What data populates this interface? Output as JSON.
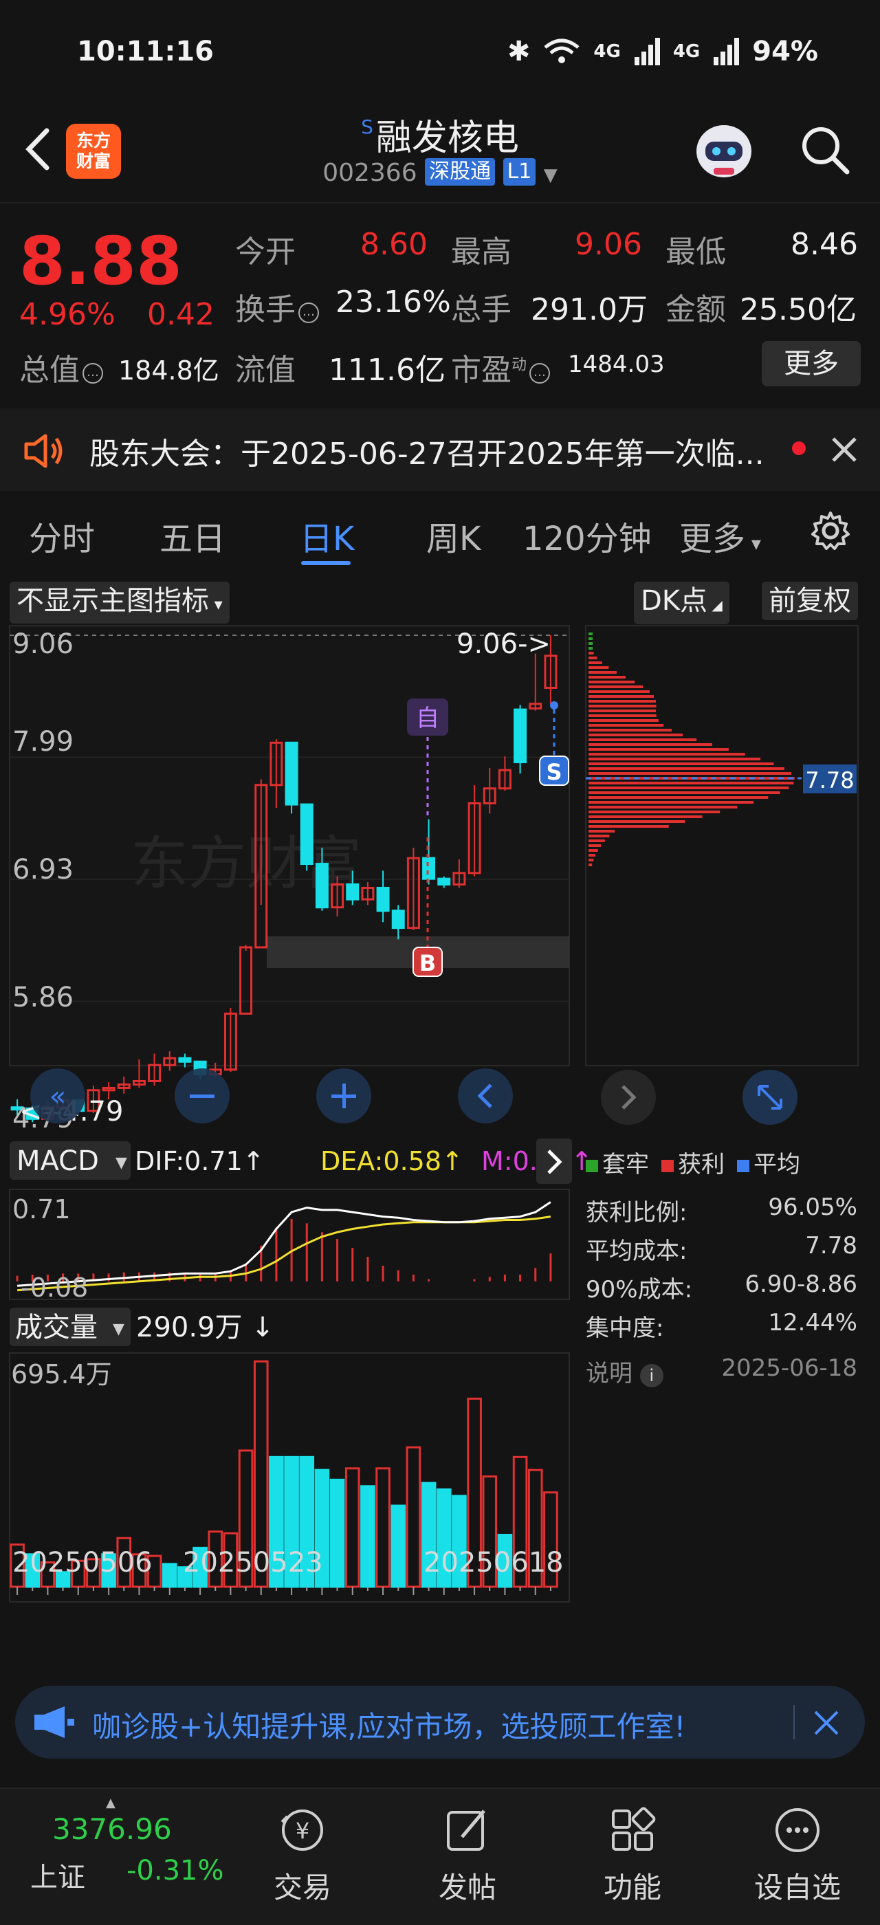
{
  "status": {
    "time": "10:11:16",
    "battery": "94%",
    "network": "4G"
  },
  "header": {
    "app_logo_line1": "东方",
    "app_logo_line2": "财富",
    "stock_name": "融发核电",
    "stock_name_prefix": "S",
    "stock_code": "002366",
    "tag_connect": "深股通",
    "tag_level": "L1"
  },
  "quote": {
    "price": "8.88",
    "change_pct": "4.96%",
    "change_abs": "0.42",
    "fields": {
      "open_label": "今开",
      "open": "8.60",
      "high_label": "最高",
      "high": "9.06",
      "low_label": "最低",
      "low": "8.46",
      "turnover_label": "换手",
      "turnover": "23.16%",
      "volume_label": "总手",
      "volume": "291.0万",
      "amount_label": "金额",
      "amount": "25.50亿",
      "mktcap_label": "总值",
      "mktcap": "184.8亿",
      "float_label": "流值",
      "float": "111.6亿",
      "pe_label": "市盈",
      "pe_sup": "动",
      "pe": "1484.03"
    },
    "more_button": "更多"
  },
  "notice": {
    "text": "股东大会：于2025-06-27召开2025年第一次临..."
  },
  "period_tabs": [
    {
      "label": "分时"
    },
    {
      "label": "五日"
    },
    {
      "label": "日K",
      "active": true
    },
    {
      "label": "周K"
    },
    {
      "label": "120分钟"
    },
    {
      "label": "更多"
    }
  ],
  "chart_toolbar": {
    "indicator_select": "不显示主图指标",
    "dk_select": "DK点",
    "adjust_select": "前复权"
  },
  "kline": {
    "y_ticks": [
      "9.06",
      "7.99",
      "6.93",
      "5.86",
      "4.79"
    ],
    "max_label": "9.06->",
    "min_label": "<--4.79",
    "chip_price_label": "7.78",
    "marker_self": "自",
    "marker_buy": "B",
    "marker_sell": "S",
    "watermark": "东方财富"
  },
  "chart_data": [
    {
      "type": "candlestick",
      "title": "",
      "ylim": [
        4.79,
        9.06
      ],
      "open": [
        4.93,
        4.92,
        4.83,
        4.93,
        4.99,
        4.9,
        5.08,
        5.1,
        5.13,
        5.16,
        5.3,
        5.36,
        5.33,
        5.22,
        5.26,
        5.75,
        6.33,
        7.75,
        8.12,
        7.58,
        7.06,
        6.68,
        6.88,
        6.75,
        6.85,
        6.65,
        6.5,
        7.11,
        6.93,
        6.88,
        6.98,
        7.59,
        7.72,
        8.41,
        8.42,
        8.6
      ],
      "close": [
        4.92,
        4.83,
        4.93,
        4.99,
        4.9,
        5.08,
        5.1,
        5.13,
        5.16,
        5.3,
        5.36,
        5.33,
        5.22,
        5.26,
        5.75,
        6.33,
        7.75,
        8.12,
        7.58,
        7.06,
        6.68,
        6.88,
        6.75,
        6.85,
        6.65,
        6.5,
        7.11,
        6.93,
        6.88,
        6.98,
        7.59,
        7.72,
        7.88,
        7.95,
        8.46,
        8.88
      ],
      "high": [
        5.0,
        4.95,
        4.98,
        5.02,
        5.0,
        5.12,
        5.15,
        5.2,
        5.35,
        5.4,
        5.42,
        5.4,
        5.3,
        5.32,
        5.8,
        6.35,
        7.8,
        8.15,
        7.75,
        7.1,
        7.2,
        6.95,
        7.0,
        6.9,
        7.0,
        6.7,
        7.2,
        7.45,
        6.95,
        7.1,
        7.75,
        7.9,
        8.0,
        8.45,
        8.9,
        9.06
      ],
      "low": [
        4.85,
        4.8,
        4.79,
        4.9,
        4.88,
        4.88,
        5.0,
        5.05,
        5.1,
        5.12,
        5.25,
        5.28,
        5.18,
        5.2,
        5.24,
        6.3,
        6.7,
        7.55,
        7.5,
        7.0,
        6.65,
        6.6,
        6.7,
        6.7,
        6.55,
        6.4,
        6.48,
        6.88,
        6.85,
        6.85,
        6.95,
        7.5,
        7.7,
        7.85,
        8.4,
        8.46
      ]
    },
    {
      "type": "line",
      "title": "MACD",
      "series": [
        {
          "name": "DIF",
          "value_label": "DIF:0.71↑"
        },
        {
          "name": "DEA",
          "value_label": "DEA:0.58↑"
        },
        {
          "name": "M",
          "value_label": "M:0.25↑"
        }
      ],
      "y_ticks": [
        "0.71",
        "-0.08"
      ],
      "dif": [
        -0.04,
        -0.03,
        -0.02,
        -0.01,
        0.0,
        0.01,
        0.02,
        0.03,
        0.04,
        0.05,
        0.06,
        0.07,
        0.07,
        0.07,
        0.09,
        0.15,
        0.28,
        0.47,
        0.62,
        0.66,
        0.64,
        0.64,
        0.62,
        0.6,
        0.58,
        0.57,
        0.55,
        0.54,
        0.53,
        0.53,
        0.54,
        0.56,
        0.57,
        0.58,
        0.62,
        0.71
      ],
      "dea": [
        -0.08,
        -0.07,
        -0.06,
        -0.05,
        -0.04,
        -0.03,
        -0.02,
        -0.01,
        0.0,
        0.01,
        0.02,
        0.03,
        0.04,
        0.04,
        0.05,
        0.07,
        0.11,
        0.18,
        0.27,
        0.34,
        0.4,
        0.44,
        0.47,
        0.49,
        0.51,
        0.52,
        0.53,
        0.53,
        0.53,
        0.53,
        0.53,
        0.54,
        0.55,
        0.55,
        0.56,
        0.58
      ],
      "m": [
        0.05,
        0.06,
        0.06,
        0.07,
        0.07,
        0.07,
        0.07,
        0.08,
        0.08,
        0.08,
        0.08,
        0.07,
        0.06,
        0.06,
        0.08,
        0.16,
        0.32,
        0.48,
        0.56,
        0.52,
        0.44,
        0.38,
        0.3,
        0.22,
        0.14,
        0.1,
        0.06,
        0.02,
        0.0,
        0.0,
        0.02,
        0.04,
        0.06,
        0.06,
        0.12,
        0.25
      ]
    },
    {
      "type": "bar",
      "title": "成交量",
      "value_label": "290.9万 ↓",
      "y_ticks": [
        "695.4万"
      ],
      "x_tick_labels": [
        "20250506",
        "20250523",
        "20250618"
      ],
      "values": [
        130,
        100,
        75,
        45,
        80,
        85,
        100,
        150,
        100,
        95,
        70,
        60,
        120,
        170,
        165,
        420,
        695,
        400,
        400,
        400,
        360,
        330,
        365,
        310,
        365,
        250,
        430,
        320,
        300,
        280,
        580,
        340,
        160,
        400,
        360,
        290.9
      ],
      "up": [
        true,
        false,
        true,
        false,
        true,
        true,
        false,
        true,
        true,
        true,
        false,
        false,
        false,
        true,
        true,
        true,
        true,
        false,
        false,
        false,
        false,
        false,
        true,
        false,
        true,
        false,
        true,
        false,
        false,
        false,
        true,
        true,
        false,
        true,
        true,
        true
      ]
    }
  ],
  "chip_panel": {
    "legend": [
      {
        "label": "套牢",
        "color": "#2aa52a"
      },
      {
        "label": "获利",
        "color": "#e03030"
      },
      {
        "label": "平均",
        "color": "#3f7ef0"
      }
    ],
    "rows": [
      {
        "label": "获利比例:",
        "value": "96.05%"
      },
      {
        "label": "平均成本:",
        "value": "7.78"
      },
      {
        "label": "90%成本:",
        "value": "6.90-8.86"
      },
      {
        "label": "集中度:",
        "value": "12.44%"
      }
    ],
    "note_label": "说明",
    "date": "2025-06-18"
  },
  "ad": {
    "text": "咖诊股+认知提升课,应对市场，选投顾工作室!"
  },
  "bottom_nav": {
    "index_value": "3376.96",
    "index_name": "上证",
    "index_change": "-0.31%",
    "items": [
      {
        "label": "交易"
      },
      {
        "label": "发帖"
      },
      {
        "label": "功能"
      },
      {
        "label": "设自选"
      }
    ]
  },
  "colors": {
    "up": "#e03030",
    "down": "#19e0e8",
    "accent": "#4a90ff",
    "dif": "#ffffff",
    "dea": "#f2e030",
    "m": "#e040e0"
  }
}
